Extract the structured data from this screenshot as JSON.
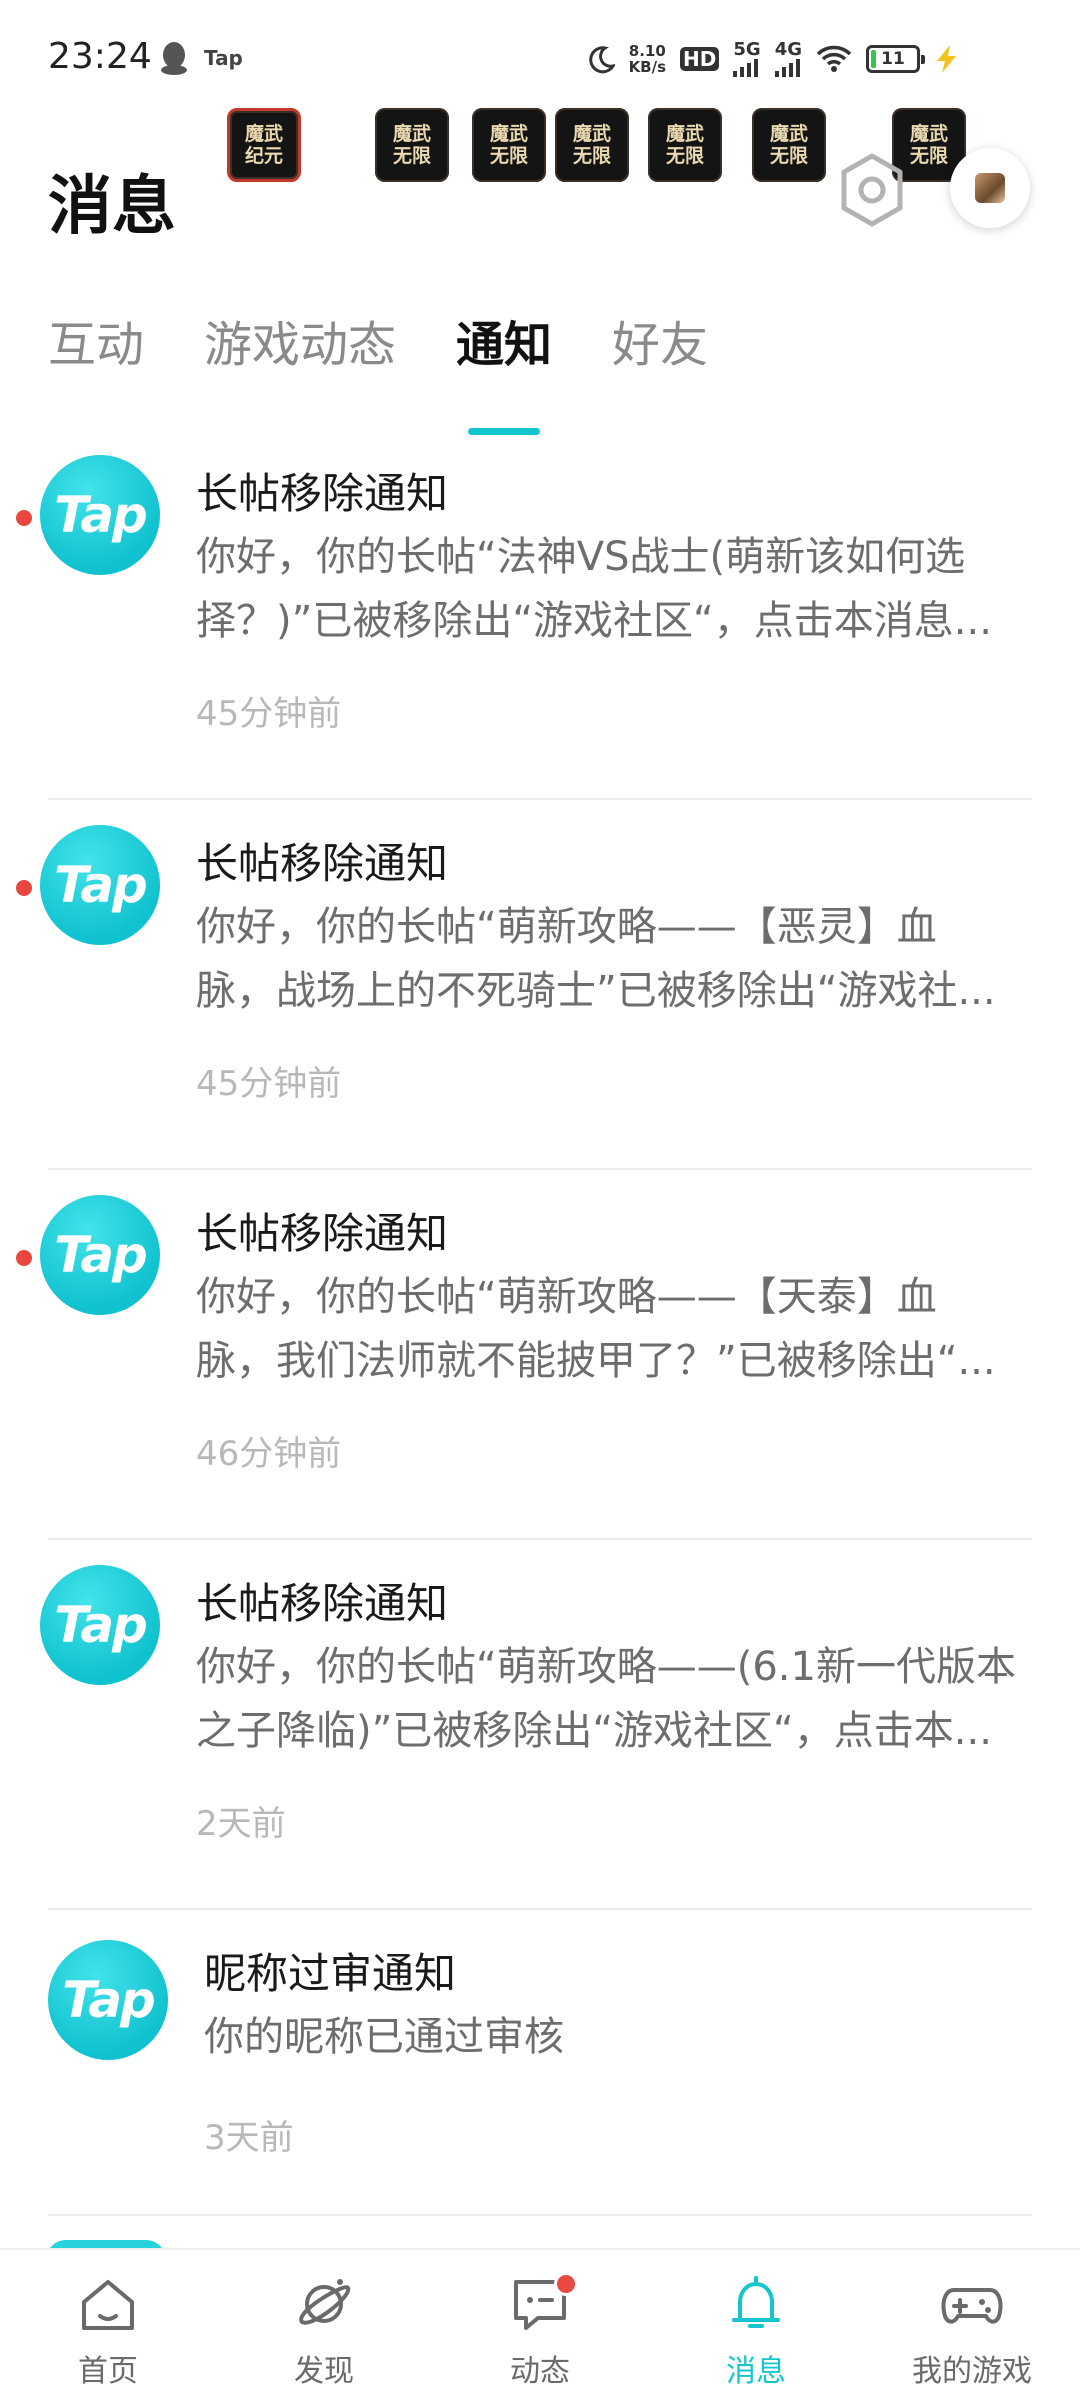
{
  "status_bar": {
    "time": "23:24",
    "notif_tap": "Tap",
    "net_speed_value": "8.10",
    "net_speed_unit": "KB/s",
    "hd": "HD",
    "net_5g": "5G",
    "net_4g": "4G",
    "battery": "11"
  },
  "game_badges": [
    {
      "line1": "魔武",
      "line2": "纪元"
    },
    {
      "line1": "魔武",
      "line2": "无限"
    },
    {
      "line1": "魔武",
      "line2": "无限"
    },
    {
      "line1": "魔武",
      "line2": "无限"
    },
    {
      "line1": "魔武",
      "line2": "无限"
    },
    {
      "line1": "魔武",
      "line2": "无限"
    },
    {
      "line1": "魔武",
      "line2": "无限"
    }
  ],
  "header": {
    "title": "消息"
  },
  "tabs": [
    {
      "label": "互动",
      "active": false
    },
    {
      "label": "游戏动态",
      "active": false
    },
    {
      "label": "通知",
      "active": true
    },
    {
      "label": "好友",
      "active": false
    }
  ],
  "notifications": [
    {
      "logo": "Tap",
      "title": "长帖移除通知",
      "body_line1": "你好，你的长帖“法神VS战士(萌新该如何选",
      "body_line2": "择？)”已被移除出“游戏社区“，点击本消息...",
      "time": "45分钟前",
      "unread": true
    },
    {
      "logo": "Tap",
      "title": "长帖移除通知",
      "body_line1": "你好，你的长帖“萌新攻略——【恶灵】血",
      "body_line2": "脉，战场上的不死骑士”已被移除出“游戏社...",
      "time": "45分钟前",
      "unread": true
    },
    {
      "logo": "Tap",
      "title": "长帖移除通知",
      "body_line1": "你好，你的长帖“萌新攻略——【天泰】血",
      "body_line2": "脉，我们法师就不能披甲了？”已被移除出“...",
      "time": "46分钟前",
      "unread": true
    },
    {
      "logo": "Tap",
      "title": "长帖移除通知",
      "body_line1": "你好，你的长帖“萌新攻略——(6.1新一代版本",
      "body_line2": "之子降临)”已被移除出“游戏社区“，点击本...",
      "time": "2天前",
      "unread": false
    },
    {
      "logo": "Tap",
      "title": "昵称过审通知",
      "body_line1": "你的昵称已通过审核",
      "body_line2": "",
      "time": "3天前",
      "unread": false
    }
  ],
  "bottom_nav": [
    {
      "label": "首页",
      "icon": "home-icon",
      "active": false
    },
    {
      "label": "发现",
      "icon": "planet-icon",
      "active": false
    },
    {
      "label": "动态",
      "icon": "chat-icon",
      "active": false,
      "badge": true
    },
    {
      "label": "消息",
      "icon": "bell-icon",
      "active": true
    },
    {
      "label": "我的游戏",
      "icon": "gamepad-icon",
      "active": false
    }
  ],
  "colors": {
    "accent": "#15c5ce",
    "unread_dot": "#e8473f",
    "text_primary": "#1a1a1a",
    "text_secondary": "#6d6d6d",
    "text_time": "#b8b8b8"
  }
}
